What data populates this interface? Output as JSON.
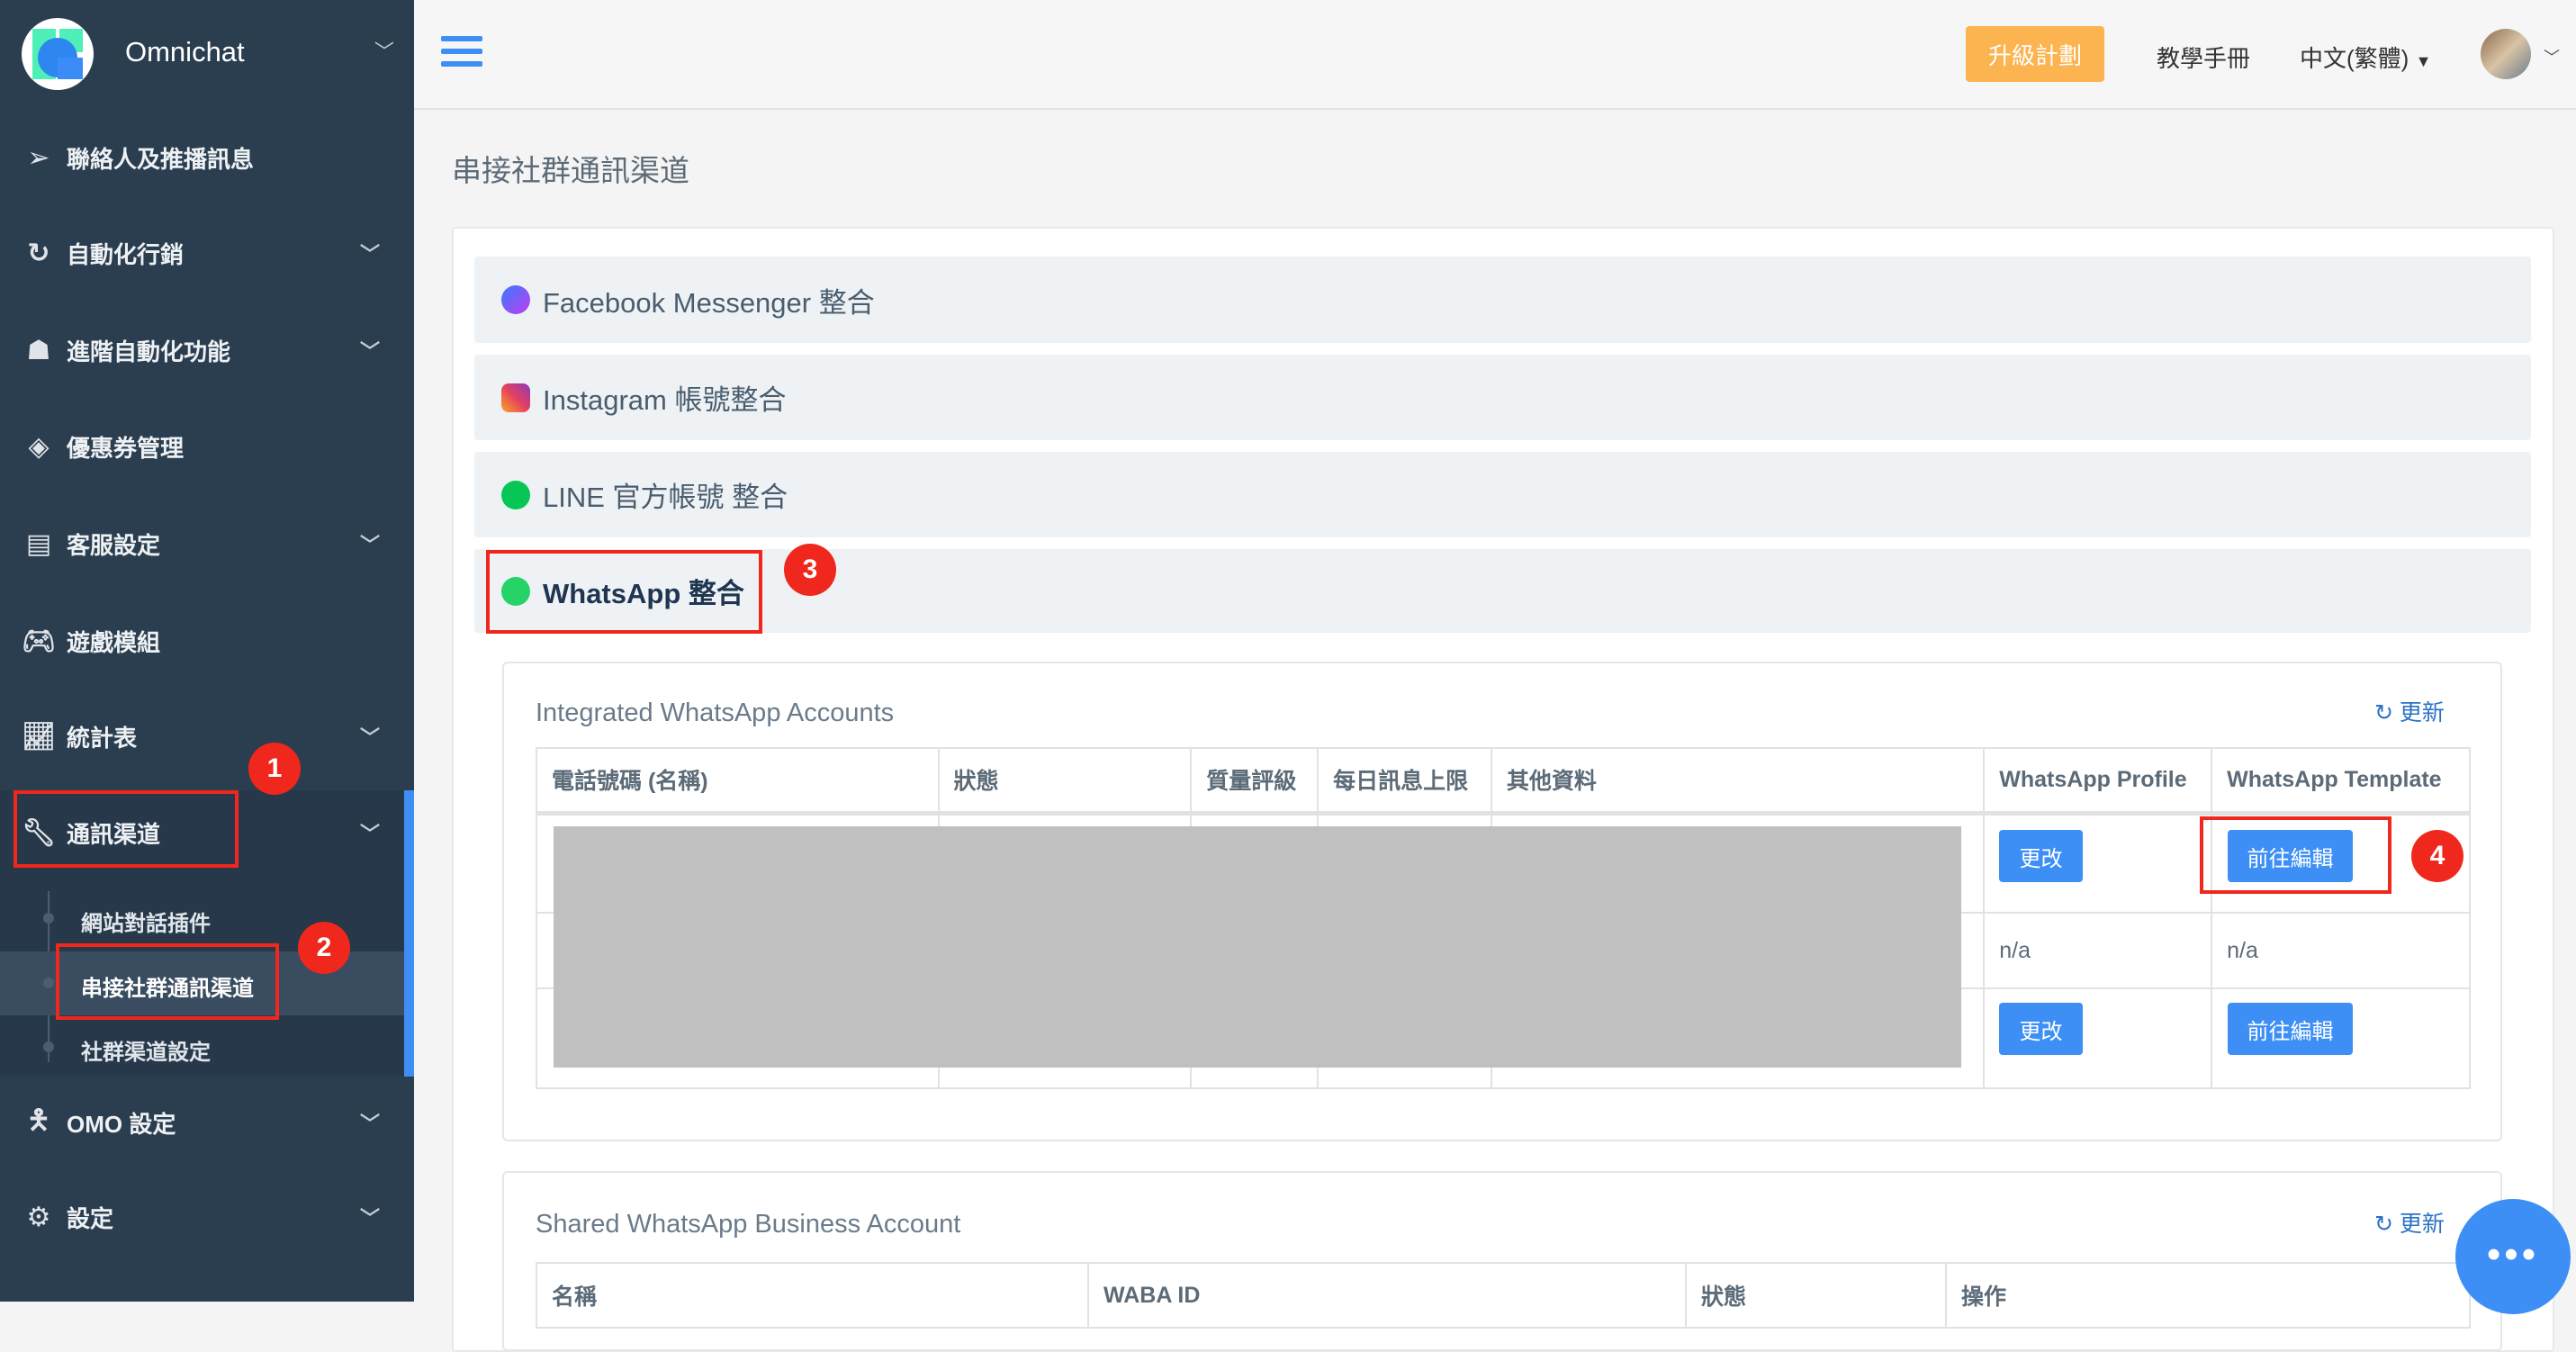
{
  "sidebar": {
    "brand": "Omnichat",
    "items": [
      {
        "label": "聯絡人及推播訊息",
        "icon": "paper-plane-icon"
      },
      {
        "label": "自動化行銷",
        "icon": "refresh-icon"
      },
      {
        "label": "進階自動化功能",
        "icon": "android-icon"
      },
      {
        "label": "優惠券管理",
        "icon": "ticket-icon"
      },
      {
        "label": "客服設定",
        "icon": "document-icon"
      },
      {
        "label": "遊戲模組",
        "icon": "gamepad-icon"
      },
      {
        "label": "統計表",
        "icon": "line-chart-icon"
      },
      {
        "label": "通訊渠道",
        "icon": "wrench-icon"
      },
      {
        "label": "OMO 設定",
        "icon": "person-icon"
      },
      {
        "label": "設定",
        "icon": "gear-icon"
      }
    ],
    "subitems": [
      "網站對話插件",
      "串接社群通訊渠道",
      "社群渠道設定"
    ]
  },
  "topbar": {
    "upgrade": "升級計劃",
    "manual": "教學手冊",
    "language": "中文(繁體)"
  },
  "page": {
    "title": "串接社群通訊渠道"
  },
  "accordion": [
    "Facebook Messenger 整合",
    "Instagram 帳號整合",
    "LINE 官方帳號 整合",
    "WhatsApp 整合"
  ],
  "integrated": {
    "title": "Integrated WhatsApp Accounts",
    "refresh": "更新",
    "headers": [
      "電話號碼 (名稱)",
      "狀態",
      "質量評級",
      "每日訊息上限",
      "其他資料",
      "WhatsApp Profile",
      "WhatsApp Template"
    ],
    "rows": [
      {
        "profile": "更改",
        "template": "前往編輯"
      },
      {
        "profile": "n/a",
        "template": "n/a"
      },
      {
        "profile": "更改",
        "template": "前往編輯"
      }
    ]
  },
  "shared": {
    "title": "Shared WhatsApp Business Account",
    "refresh": "更新",
    "headers": [
      "名稱",
      "WABA ID",
      "狀態",
      "操作"
    ]
  },
  "annotations": [
    "1",
    "2",
    "3",
    "4"
  ],
  "colors": {
    "sidebar": "#2b3e50",
    "accent": "#3d8ff5",
    "upgrade": "#fbb450",
    "annotation": "#f0271c"
  }
}
